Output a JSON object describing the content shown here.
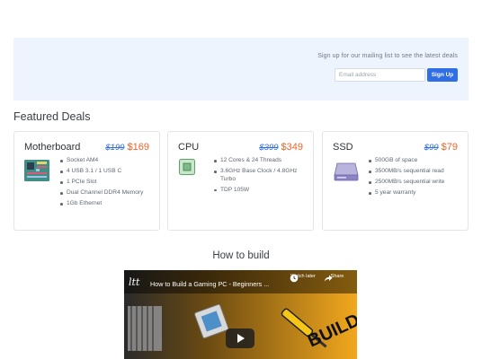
{
  "signup": {
    "text": "Sign up for our mailing list to see the latest deals",
    "email_placeholder": "Email address",
    "button_label": "Sign Up"
  },
  "featured": {
    "title": "Featured Deals",
    "cards": [
      {
        "name": "Motherboard",
        "old_price": "$199",
        "new_price": "$169",
        "icon": "motherboard-icon",
        "specs": [
          "Socket AM4",
          "4 USB 3.1 / 1 USB C",
          "1 PCIe Slot",
          "Dual Channel DDR4 Memory",
          "1Gb Ethernet"
        ]
      },
      {
        "name": "CPU",
        "old_price": "$399",
        "new_price": "$349",
        "icon": "cpu-icon",
        "specs": [
          "12 Cores & 24 Threads",
          "3.6GHz Base Clock / 4.8GHz Turbo",
          "TDP 105W"
        ]
      },
      {
        "name": "SSD",
        "old_price": "$99",
        "new_price": "$79",
        "icon": "ssd-icon",
        "specs": [
          "500GB of space",
          "3500MB/s sequential read",
          "2500MB/s sequential write",
          "5 year warranty"
        ]
      }
    ]
  },
  "howto": {
    "title": "How to build",
    "video": {
      "channel_logo": "ltt",
      "title": "How to Build a Gaming PC - Beginners ...",
      "watch_later": "Watch later",
      "share": "Share"
    }
  },
  "colors": {
    "accent": "#2f6ee4",
    "sale": "#f0622a",
    "banner_bg": "#eef4fd"
  }
}
